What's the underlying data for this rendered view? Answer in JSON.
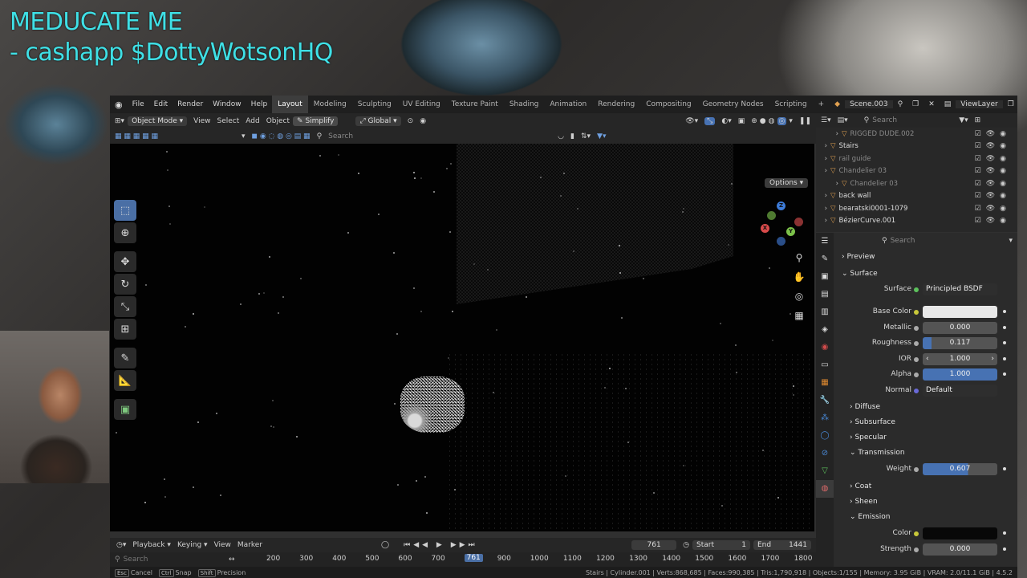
{
  "overlay": {
    "line1": "MEDUCATE ME",
    "line2": "- cashapp $DottyWotsonHQ"
  },
  "menu": [
    "File",
    "Edit",
    "Render",
    "Window",
    "Help"
  ],
  "workspaces": [
    "Layout",
    "Modeling",
    "Sculpting",
    "UV Editing",
    "Texture Paint",
    "Shading",
    "Animation",
    "Rendering",
    "Compositing",
    "Geometry Nodes",
    "Scripting"
  ],
  "active_workspace": "Layout",
  "scene": {
    "name": "Scene.003",
    "view_layer": "ViewLayer"
  },
  "viewport_header": {
    "mode": "Object Mode",
    "menus": [
      "View",
      "Select",
      "Add",
      "Object"
    ],
    "simplify": "Simplify",
    "transform": "Global",
    "search_placeholder": "Search",
    "options": "Options"
  },
  "outliner": {
    "search_placeholder": "Search",
    "rows": [
      {
        "label": "RIGGED DUDE.002",
        "dim": true
      },
      {
        "label": "Stairs",
        "dim": false
      },
      {
        "label": "rail guide",
        "dim": true
      },
      {
        "label": "Chandelier 03",
        "dim": true
      },
      {
        "label": "Chandelier 03",
        "dim": true
      },
      {
        "label": "back wall",
        "dim": false
      },
      {
        "label": "bearatski0001-1079",
        "dim": false
      },
      {
        "label": "BézierCurve.001",
        "dim": false
      }
    ]
  },
  "properties": {
    "search_placeholder": "Search",
    "sections": {
      "preview": "Preview",
      "surface": "Surface",
      "diffuse": "Diffuse",
      "subsurface": "Subsurface",
      "specular": "Specular",
      "transmission": "Transmission",
      "coat": "Coat",
      "sheen": "Sheen",
      "emission": "Emission"
    },
    "surface_label": "Surface",
    "surface_shader": "Principled BSDF",
    "base_color_label": "Base Color",
    "metallic": {
      "label": "Metallic",
      "value": "0.000"
    },
    "roughness": {
      "label": "Roughness",
      "value": "0.117",
      "fill": 0.117
    },
    "ior": {
      "label": "IOR",
      "value": "1.000"
    },
    "alpha": {
      "label": "Alpha",
      "value": "1.000",
      "fill": 1.0
    },
    "normal": {
      "label": "Normal",
      "value": "Default"
    },
    "weight": {
      "label": "Weight",
      "value": "0.607",
      "fill": 0.607
    },
    "emission_color_label": "Color",
    "strength": {
      "label": "Strength",
      "value": "0.000"
    }
  },
  "timeline": {
    "menus": [
      "Playback",
      "Keying",
      "View",
      "Marker"
    ],
    "current_frame": "761",
    "start_label": "Start",
    "start": "1",
    "end_label": "End",
    "end": "1441",
    "ruler_search": "Search",
    "ticks": [
      "200",
      "300",
      "400",
      "500",
      "600",
      "700",
      "761",
      "900",
      "1000",
      "1100",
      "1200",
      "1300",
      "1400",
      "1500",
      "1600",
      "1700",
      "1800"
    ]
  },
  "status": {
    "keys": [
      {
        "key": "Esc",
        "label": "Cancel"
      },
      {
        "key": "Ctrl",
        "label": "Snap"
      },
      {
        "key": "Shift",
        "label": "Precision"
      }
    ],
    "right": "Stairs | Cylinder.001 | Verts:868,685 | Faces:990,385 | Tris:1,790,918 | Objects:1/155 | Memory: 3.95 GiB | VRAM: 2.0/11.1 GiB | 4.5.2"
  },
  "colors": {
    "accent": "#4772b3",
    "overlay_text": "#3fe0e6"
  }
}
